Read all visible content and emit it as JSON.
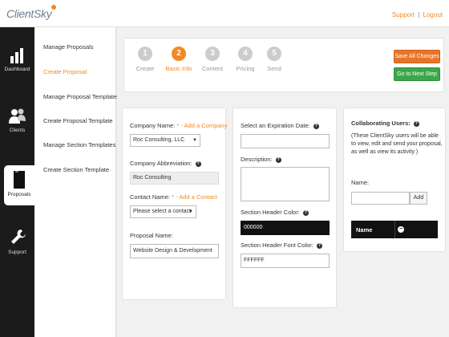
{
  "header": {
    "logo": "ClientSky",
    "support": "Support",
    "separator": "|",
    "logout": "Logout"
  },
  "leftnav": [
    {
      "label": "Dashboard",
      "icon": "bar-chart-icon"
    },
    {
      "label": "Clients",
      "icon": "users-icon"
    },
    {
      "label": "Proposals",
      "icon": "document-icon",
      "active": true
    },
    {
      "label": "Support",
      "icon": "wrench-icon"
    }
  ],
  "subnav": [
    {
      "label": "Manage Proposals"
    },
    {
      "label": "Create Proposal",
      "active": true
    },
    {
      "label": "Manage Proposal Templates"
    },
    {
      "label": "Create Proposal Template"
    },
    {
      "label": "Manage Section Templates"
    },
    {
      "label": "Create Section Template"
    }
  ],
  "steps": [
    {
      "num": "1",
      "label": "Create"
    },
    {
      "num": "2",
      "label": "Basic Info",
      "active": true
    },
    {
      "num": "3",
      "label": "Content"
    },
    {
      "num": "4",
      "label": "Pricing"
    },
    {
      "num": "5",
      "label": "Send"
    }
  ],
  "actions": {
    "save_all": "Save All Changes",
    "next_step": "Go to Next Step"
  },
  "form1": {
    "company_label": "Company Name:",
    "required": "*",
    "add_company": "- Add a Company",
    "company_value": "Roc Consulting, LLC",
    "abbrev_label": "Company Abbreviation:",
    "abbrev_value": "Roc Consulting",
    "contact_label": "Contact Name:",
    "add_contact": "- Add a Contact",
    "contact_value": "Please select a contact",
    "proposal_label": "Proposal Name:",
    "proposal_value": "Website Design & Development"
  },
  "form2": {
    "expiration_label": "Select an Expiration Date:",
    "description_label": "Description:",
    "section_header_color_label": "Section Header Color:",
    "section_header_color_value": "000000",
    "section_header_font_color_label": "Section Header Font Color:",
    "section_header_font_color_value": "FFFFFF"
  },
  "collab": {
    "title": "Collaborating Users:",
    "note": "(These ClientSky users will be able to view, edit and send your proposal, as well as view its activity )",
    "name_label": "Name:",
    "add_button": "Add",
    "col_name": "Name"
  },
  "colors": {
    "accent": "#f08a24",
    "save_button": "#e8742a",
    "next_button": "#3aa84a",
    "sidebar": "#1b1b1b"
  }
}
